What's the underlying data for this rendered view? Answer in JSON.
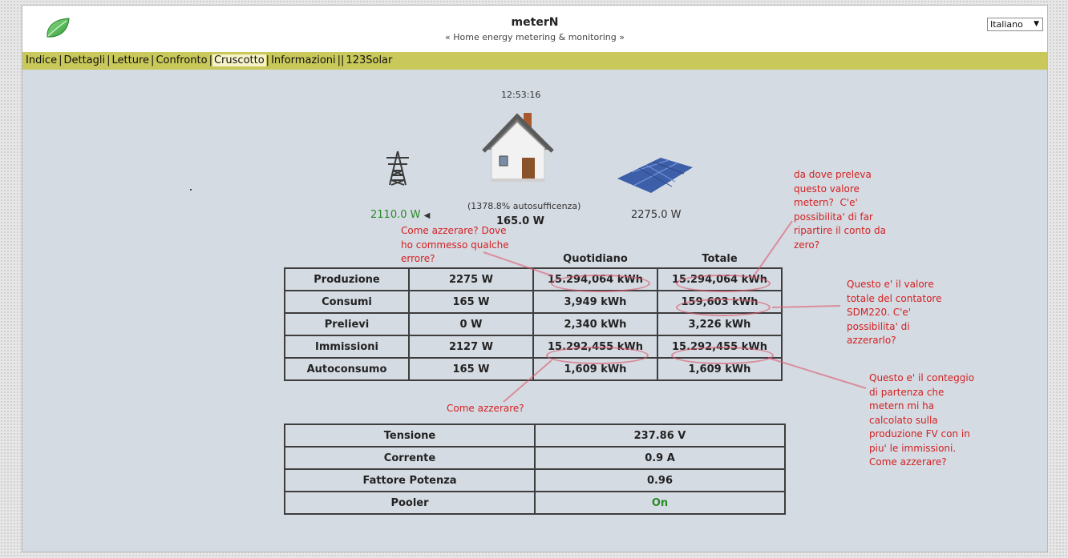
{
  "header": {
    "title": "meterN",
    "subtitle": "« Home energy metering & monitoring »",
    "language": "Italiano"
  },
  "nav": {
    "items": [
      "Indice",
      "Dettagli",
      "Letture",
      "Confronto",
      "Cruscotto",
      "Informazioni",
      "123Solar"
    ],
    "active": "Cruscotto"
  },
  "dashboard": {
    "clock": "12:53:16",
    "grid_watts": "2110.0 W",
    "autosufficiency": "(1378.8% autosufficenza)",
    "home_watts": "165.0 W",
    "pv_watts": "2275.0 W"
  },
  "energy_table": {
    "headers": [
      "",
      "",
      "Quotidiano",
      "Totale"
    ],
    "rows": [
      [
        "Produzione",
        "2275 W",
        "15.294,064 kWh",
        "15.294,064 kWh"
      ],
      [
        "Consumi",
        "165 W",
        "3,949 kWh",
        "159,603 kWh"
      ],
      [
        "Prelievi",
        "0 W",
        "2,340 kWh",
        "3,226 kWh"
      ],
      [
        "Immissioni",
        "2127 W",
        "15.292,455 kWh",
        "15.292,455 kWh"
      ],
      [
        "Autoconsumo",
        "165 W",
        "1,609 kWh",
        "1,609 kWh"
      ]
    ]
  },
  "electrical_table": {
    "rows": [
      [
        "Tensione",
        "237.86 V"
      ],
      [
        "Corrente",
        "0.9 A"
      ],
      [
        "Fattore Potenza",
        "0.96"
      ],
      [
        "Pooler",
        "On"
      ]
    ]
  },
  "annotations": {
    "note1": "Come azzerare? Dove\nho commesso qualche\nerrore?",
    "note2": "da dove preleva\nquesto valore\nmetern?  C'e'\npossibilita' di far\nripartire il conto da\nzero?",
    "note3": "Questo e' il valore\ntotale del contatore\nSDM220. C'e'\npossibilita' di\nazzerarlo?",
    "note4": "Come azzerare?",
    "note5": "Questo e' il conteggio\ndi partenza che\nmetern mi ha\ncalcolato sulla\nproduzione FV con in\npiu' le immissioni.\nCome azzerare?"
  },
  "colors": {
    "page_bg": "#d5dbe3",
    "nav_bg": "#c9c85a",
    "annotation": "#d42020",
    "positive": "#2a8a2a"
  }
}
